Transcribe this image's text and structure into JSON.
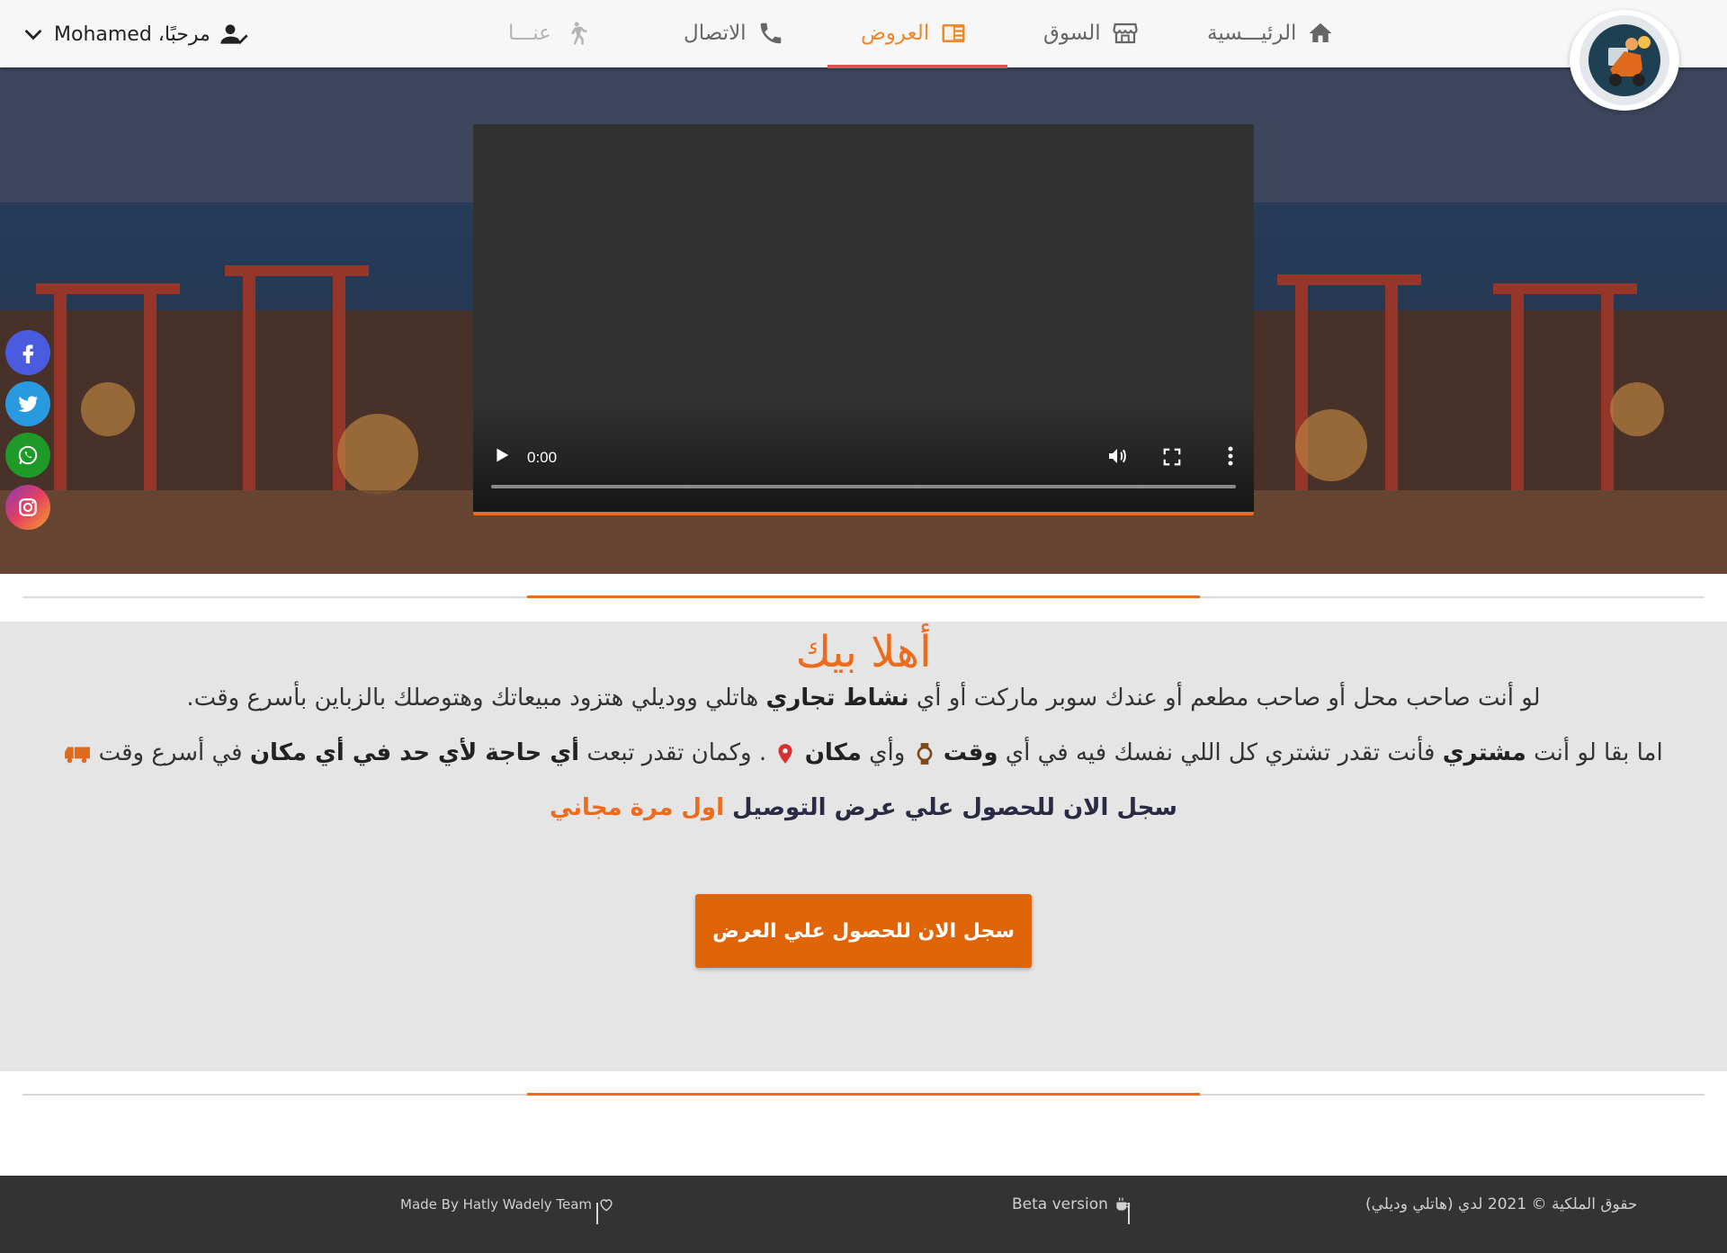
{
  "navbar": {
    "user_greeting": "مرحبًا، Mohamed",
    "items": [
      {
        "label": "الرئيـــسية",
        "icon": "home-icon"
      },
      {
        "label": "السوق",
        "icon": "store-icon"
      },
      {
        "label": "العروض",
        "icon": "offers-icon",
        "active": true
      },
      {
        "label": "الاتصال",
        "icon": "phone-icon"
      },
      {
        "label": "عنـــا",
        "icon": "walking-icon",
        "disabled": true
      }
    ]
  },
  "video": {
    "time": "0:00"
  },
  "social": [
    "facebook-icon",
    "twitter-icon",
    "whatsapp-icon",
    "instagram-icon"
  ],
  "welcome": {
    "title": "أهلا بيك",
    "line1": {
      "part1": "لو أنت صاحب محل أو صاحب مطعم أو عندك سوبر ماركت أو أي ",
      "bold1": "نشاط تجاري",
      "part2": " هاتلي ووديلي هتزود مبيعاتك وهتوصلك بالزباين بأسرع وقت."
    },
    "line2": {
      "part1": "اما بقا لو أنت ",
      "bold1": "مشتري",
      "part2": " فأنت تقدر تشتري كل اللي نفسك فيه في أي ",
      "bold2": "وقت",
      "part3": " وأي ",
      "bold3": "مكان",
      "part4": " . وكمان تقدر تبعت ",
      "bold4": "أي حاجة لأي حد في أي مكان",
      "part5": " في أسرع وقت"
    },
    "line3": {
      "main": "سجل الان للحصول علي عرض التوصيل ",
      "highlight": "اول مرة مجاني"
    },
    "cta_label": "سجل الان للحصول علي العرض"
  },
  "footer": {
    "copyright": "حقوق الملكية © 2021 لدي (هاتلي وديلي)",
    "beta": "Beta version",
    "made_by": "Made By Hatly Wadely Team"
  },
  "colors": {
    "accent": "#ee6b1c",
    "nav_active": "#f0882a",
    "nav_underline": "#e05252",
    "footer_bg": "#333333"
  }
}
